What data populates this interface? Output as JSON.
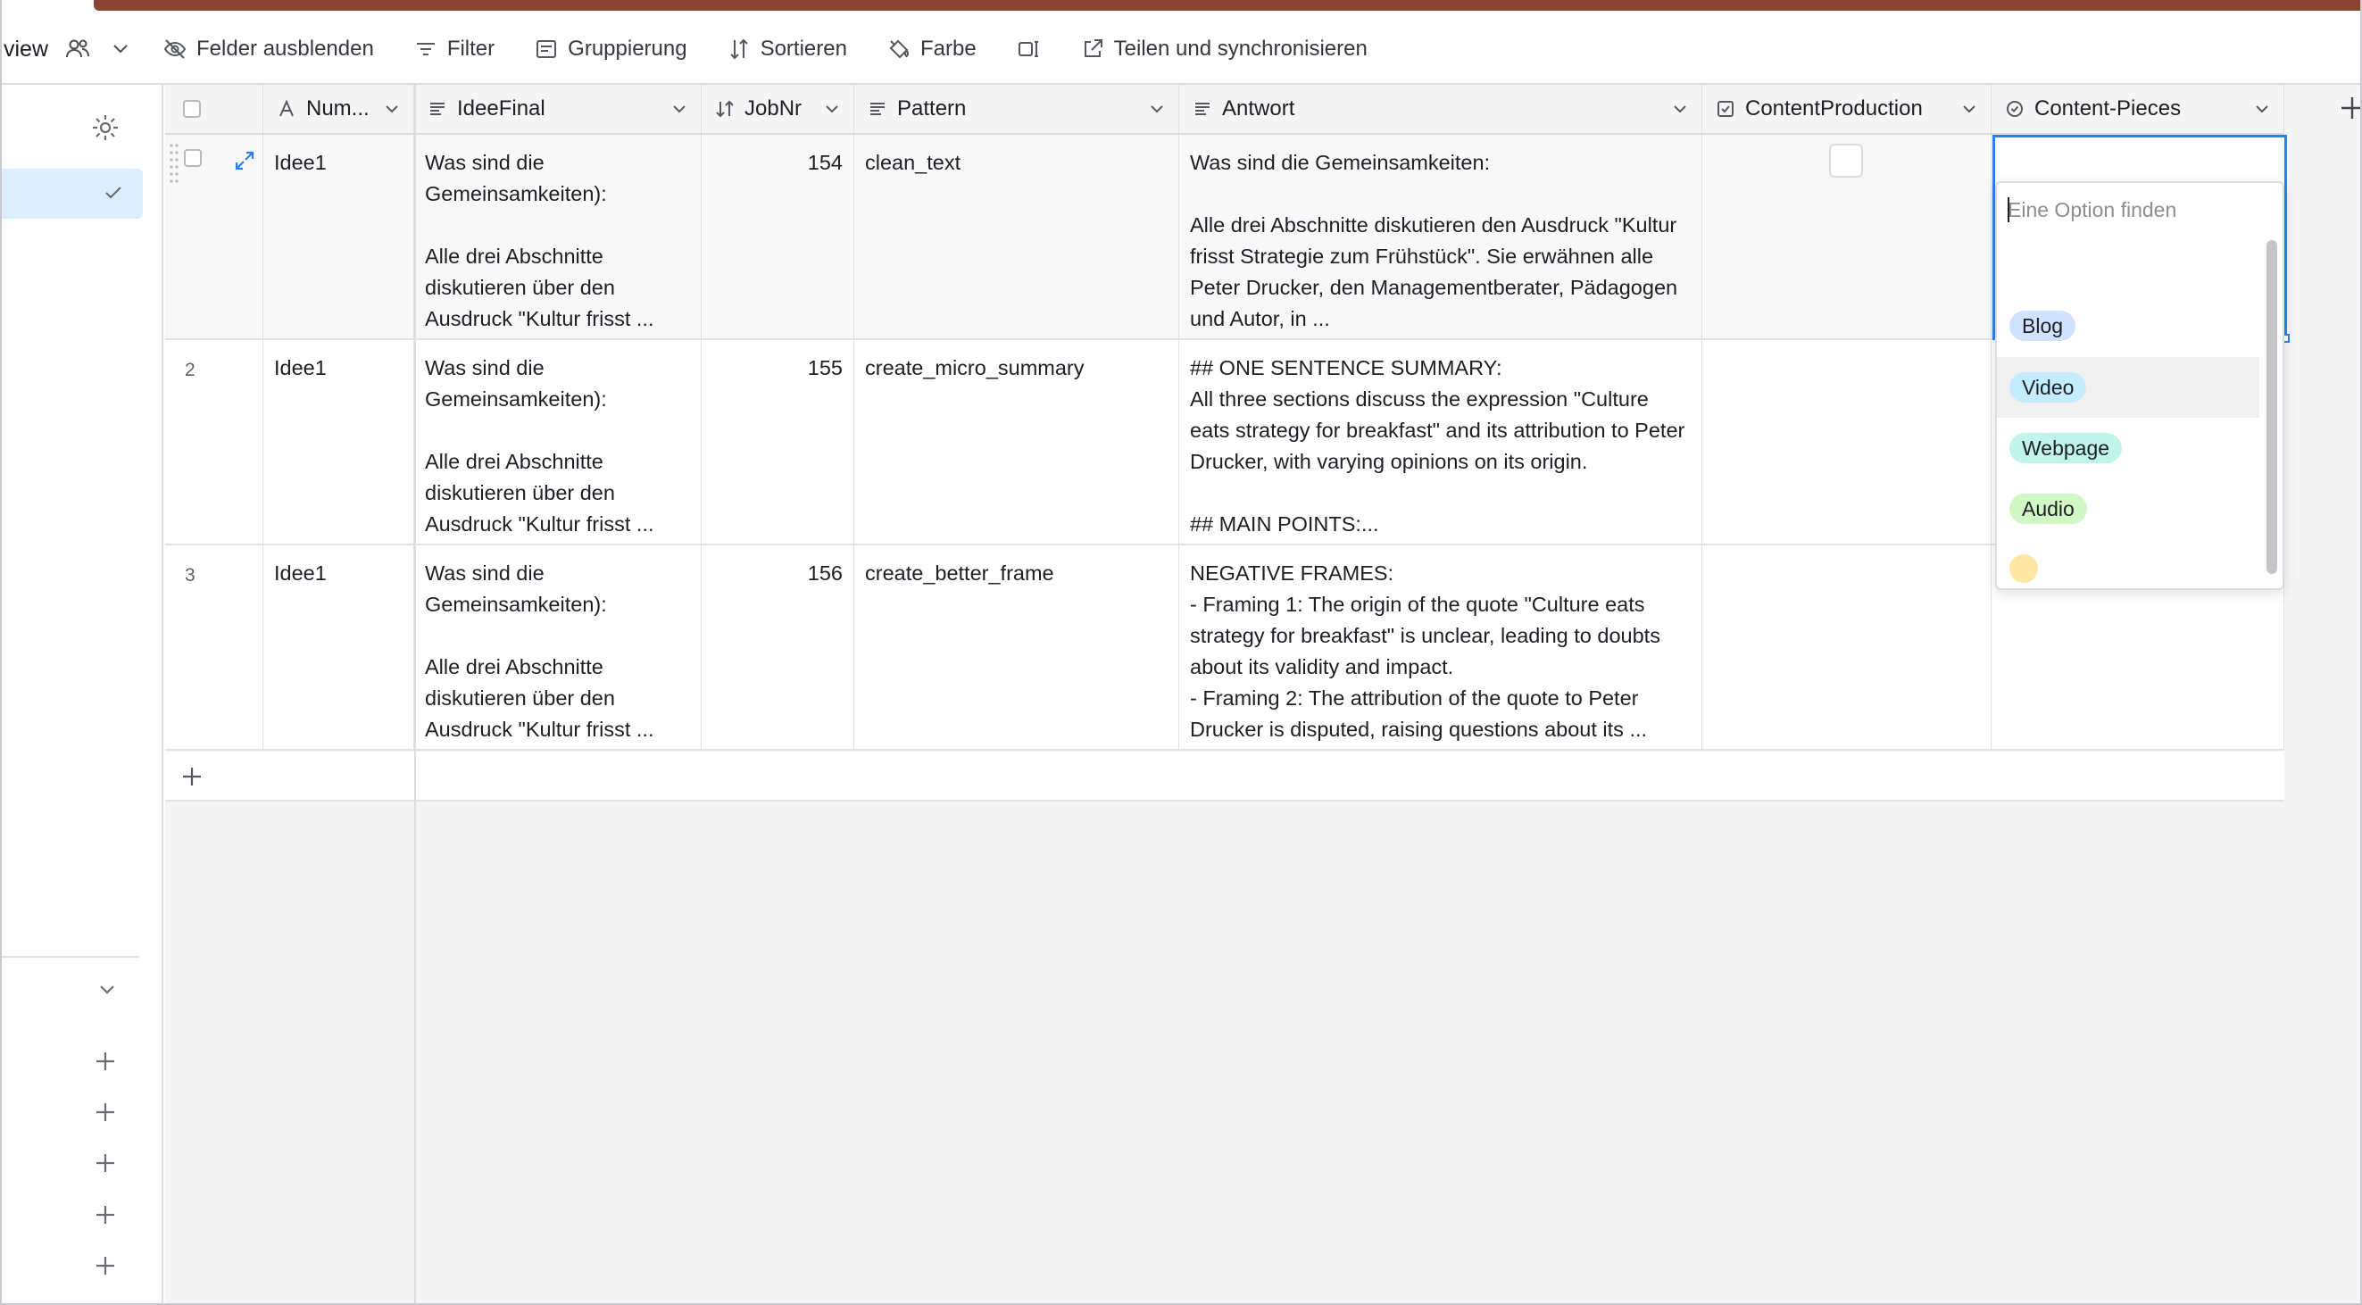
{
  "view": {
    "name": "view"
  },
  "toolbar": {
    "hide_fields": "Felder ausblenden",
    "filter": "Filter",
    "group": "Gruppierung",
    "sort": "Sortieren",
    "color": "Farbe",
    "share": "Teilen und synchronisieren"
  },
  "columns": [
    {
      "label": "Num...",
      "icon": "primary-field-icon"
    },
    {
      "label": "IdeeFinal",
      "icon": "long-text-icon"
    },
    {
      "label": "JobNr",
      "icon": "number-icon"
    },
    {
      "label": "Pattern",
      "icon": "long-text-icon"
    },
    {
      "label": "Antwort",
      "icon": "long-text-icon"
    },
    {
      "label": "ContentProduction",
      "icon": "checkbox-field-icon"
    },
    {
      "label": "Content-Pieces",
      "icon": "single-select-icon"
    }
  ],
  "rows": [
    {
      "num": "",
      "name": "Idee1",
      "idee": "Was sind die Gemeinsamkeiten):\n\nAlle drei Abschnitte diskutieren über den Ausdruck \"Kultur frisst ...",
      "jobnr": "154",
      "pattern": "clean_text",
      "antwort": "Was sind die Gemeinsamkeiten:\n\nAlle drei Abschnitte diskutieren den Ausdruck \"Kultur frisst Strategie zum Frühstück\". Sie erwähnen alle Peter Drucker, den Managementberater, Pädagogen und Autor, in ..."
    },
    {
      "num": "2",
      "name": "Idee1",
      "idee": "Was sind die Gemeinsamkeiten):\n\nAlle drei Abschnitte diskutieren über den Ausdruck \"Kultur frisst ...",
      "jobnr": "155",
      "pattern": "create_micro_summary",
      "antwort": "## ONE SENTENCE SUMMARY:\nAll three sections discuss the expression \"Culture eats strategy for breakfast\" and its attribution to Peter Drucker, with varying opinions on its origin.\n\n## MAIN POINTS:..."
    },
    {
      "num": "3",
      "name": "Idee1",
      "idee": "Was sind die Gemeinsamkeiten):\n\nAlle drei Abschnitte diskutieren über den Ausdruck \"Kultur frisst ...",
      "jobnr": "156",
      "pattern": "create_better_frame",
      "antwort": "NEGATIVE FRAMES:\n- Framing 1: The origin of the quote \"Culture eats strategy for breakfast\" is unclear, leading to doubts about its validity and impact.\n- Framing 2: The attribution of the quote to Peter Drucker is disputed, raising questions about its ..."
    }
  ],
  "dropdown": {
    "search_placeholder": "Eine Option finden",
    "options": [
      {
        "label": "Blog",
        "color": "#d1e2ff"
      },
      {
        "label": "Video",
        "color": "#c4ecff"
      },
      {
        "label": "Webpage",
        "color": "#c2f5e9"
      },
      {
        "label": "Audio",
        "color": "#d1f7c4"
      }
    ],
    "partial_option_color": "#ffe7a6"
  },
  "colors": {
    "accent_bar": "#8a4433",
    "selection": "#2d7ff9",
    "sidebar_active": "#dceefd"
  }
}
